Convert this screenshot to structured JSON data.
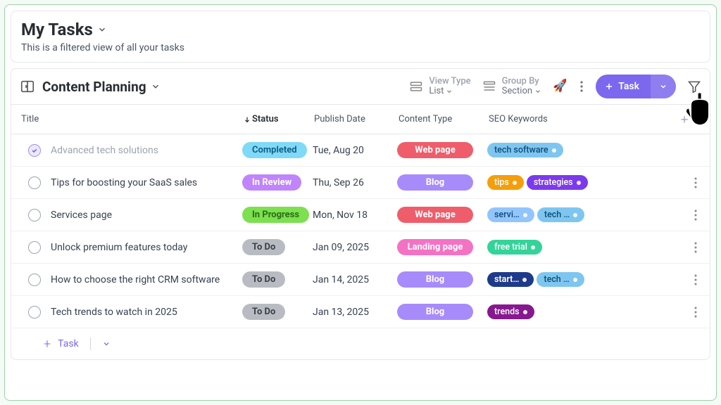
{
  "header": {
    "title": "My Tasks",
    "subtitle": "This is a filtered view of all your tasks"
  },
  "board": {
    "title": "Content Planning"
  },
  "toolbar": {
    "viewtype_label": "View Type",
    "viewtype_value": "List",
    "groupby_label": "Group By",
    "groupby_value": "Section",
    "task_btn": "Task"
  },
  "columns": {
    "title": "Title",
    "status": "Status",
    "publish": "Publish Date",
    "type": "Content Type",
    "seo": "SEO Keywords"
  },
  "rows": [
    {
      "done": true,
      "title": "Advanced tech solutions",
      "status": "Completed",
      "status_class": "p-completed",
      "date": "Tue, Aug 20",
      "type": "Web page",
      "type_class": "p-webpage",
      "tags": [
        {
          "text": "tech software",
          "cls": "t-skyblue"
        }
      ]
    },
    {
      "done": false,
      "title": "Tips for boosting your SaaS sales",
      "status": "In Review",
      "status_class": "p-inreview",
      "date": "Thu, Sep 26",
      "type": "Blog",
      "type_class": "p-blog",
      "tags": [
        {
          "text": "tips",
          "cls": "t-orange"
        },
        {
          "text": "strategies",
          "cls": "t-purple"
        }
      ]
    },
    {
      "done": false,
      "title": "Services page",
      "status": "In Progress",
      "status_class": "p-inprogress",
      "date": "Mon, Nov 18",
      "type": "Web page",
      "type_class": "p-webpage",
      "tags": [
        {
          "text": "servi…",
          "cls": "t-skyblue2"
        },
        {
          "text": "tech …",
          "cls": "t-skyblue"
        }
      ]
    },
    {
      "done": false,
      "title": "Unlock premium features today",
      "status": "To Do",
      "status_class": "p-todo",
      "date": "Jan 09, 2025",
      "type": "Landing page",
      "type_class": "p-landing",
      "tags": [
        {
          "text": "free trial",
          "cls": "t-green"
        }
      ]
    },
    {
      "done": false,
      "title": "How to choose the right CRM software",
      "status": "To Do",
      "status_class": "p-todo",
      "date": "Jan 14, 2025",
      "type": "Blog",
      "type_class": "p-blog",
      "tags": [
        {
          "text": "start…",
          "cls": "t-navy"
        },
        {
          "text": "tech …",
          "cls": "t-skyblue"
        }
      ]
    },
    {
      "done": false,
      "title": "Tech trends to watch in 2025",
      "status": "To Do",
      "status_class": "p-todo",
      "date": "Jan 13, 2025",
      "type": "Blog",
      "type_class": "p-blog",
      "tags": [
        {
          "text": "trends",
          "cls": "t-darkpurple"
        }
      ]
    }
  ],
  "addrow": {
    "label": "Task"
  }
}
